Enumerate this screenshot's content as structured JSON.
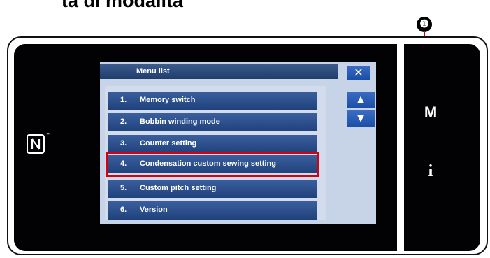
{
  "heading": "ta di modalità",
  "callout_number": "❶",
  "left_panel": {
    "nfc_logo_mark": "N",
    "trademark": "™"
  },
  "right_panel": {
    "mode_key_label": "M",
    "info_key_label": "i"
  },
  "menu_window": {
    "title": "Menu list",
    "close_label": "✕",
    "scroll_up_label": "▲",
    "scroll_down_label": "▼",
    "items": [
      {
        "num": "1.",
        "label": "Memory switch"
      },
      {
        "num": "2.",
        "label": "Bobbin winding mode"
      },
      {
        "num": "3.",
        "label": "Counter setting"
      },
      {
        "num": "4.",
        "label": "Condensation custom sewing setting",
        "highlighted": true
      },
      {
        "num": "5.",
        "label": "Custom pitch setting"
      },
      {
        "num": "6.",
        "label": "Version"
      }
    ]
  },
  "colors": {
    "screen_bg": "#020204",
    "window_bg": "#c7d4e8",
    "item_bg": "#2b4d8a",
    "titlebar_bg": "#2c4b7c",
    "button_bg": "#2a5cb6",
    "highlight_border": "#d6000f",
    "callout_line": "#d6000f"
  }
}
